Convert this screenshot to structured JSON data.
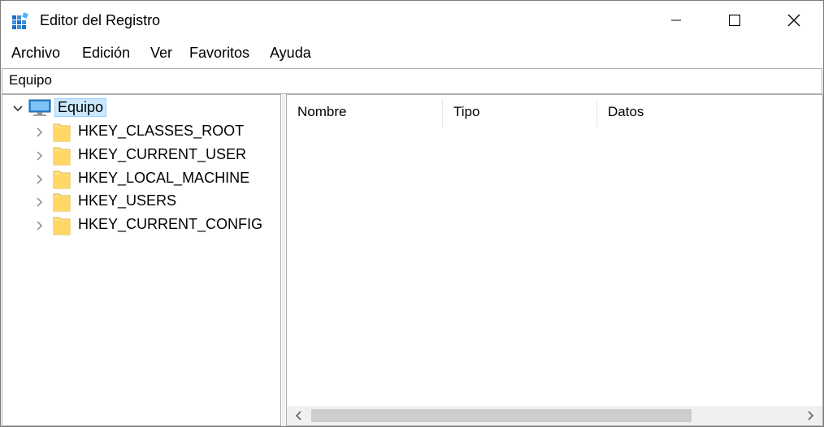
{
  "window": {
    "title": "Editor del Registro"
  },
  "menu": {
    "items": [
      "Archivo",
      "Edición",
      "Ver",
      "Favoritos",
      "Ayuda"
    ]
  },
  "address": {
    "path": "Equipo"
  },
  "tree": {
    "root": "Equipo",
    "children": [
      "HKEY_CLASSES_ROOT",
      "HKEY_CURRENT_USER",
      "HKEY_LOCAL_MACHINE",
      "HKEY_USERS",
      "HKEY_CURRENT_CONFIG"
    ]
  },
  "list": {
    "columns": [
      "Nombre",
      "Tipo",
      "Datos"
    ]
  },
  "colors": {
    "selection": "#cce8ff",
    "folder": "#ffd766",
    "computer": "#2b88d8"
  },
  "icons": {
    "app": "registry-editor-icon",
    "minimize": "minimize-icon",
    "maximize": "maximize-icon",
    "close": "close-icon",
    "computer": "computer-icon",
    "folder": "folder-icon",
    "expand": "chevron-right-icon",
    "collapse": "chevron-down-icon"
  }
}
